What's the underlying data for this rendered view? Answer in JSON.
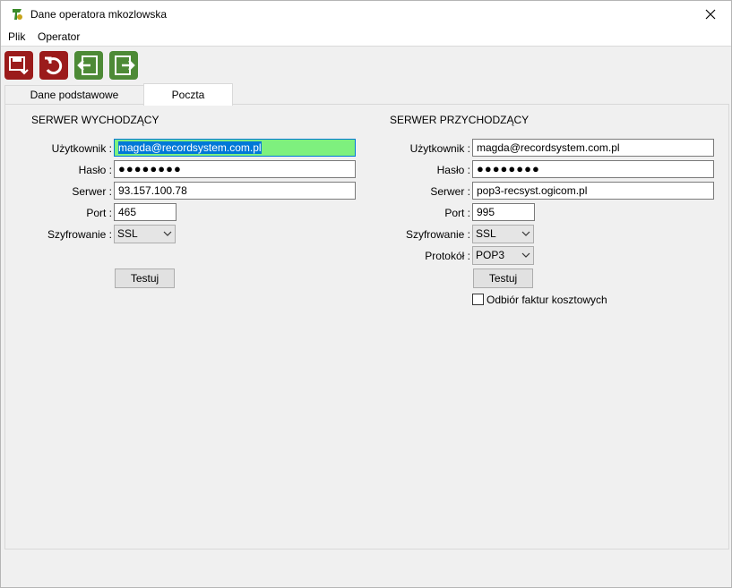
{
  "window": {
    "title": "Dane operatora mkozlowska"
  },
  "menu": {
    "items": [
      "Plik",
      "Operator"
    ]
  },
  "tabs": [
    {
      "label": "Dane podstawowe",
      "active": false
    },
    {
      "label": "Poczta",
      "active": true
    }
  ],
  "outgoing": {
    "title": "SERWER WYCHODZĄCY",
    "user_label": "Użytkownik :",
    "user_value": "magda@recordsystem.com.pl",
    "password_label": "Hasło :",
    "password_value": "●●●●●●●●",
    "server_label": "Serwer :",
    "server_value": "93.157.100.78",
    "port_label": "Port :",
    "port_value": "465",
    "encryption_label": "Szyfrowanie :",
    "encryption_value": "SSL",
    "test_label": "Testuj"
  },
  "incoming": {
    "title": "SERWER PRZYCHODZĄCY",
    "user_label": "Użytkownik :",
    "user_value": "magda@recordsystem.com.pl",
    "password_label": "Hasło :",
    "password_value": "●●●●●●●●",
    "server_label": "Serwer :",
    "server_value": "pop3-recsyst.ogicom.pl",
    "port_label": "Port :",
    "port_value": "995",
    "encryption_label": "Szyfrowanie :",
    "encryption_value": "SSL",
    "protocol_label": "Protokół :",
    "protocol_value": "POP3",
    "test_label": "Testuj",
    "cost_invoices_label": "Odbiór faktur kosztowych",
    "cost_invoices_checked": false
  },
  "colors": {
    "toolbar_red": "#9b1b1b",
    "toolbar_green": "#4d8a36",
    "focus_highlight": "#7ef07e",
    "selection": "#0078d7"
  }
}
